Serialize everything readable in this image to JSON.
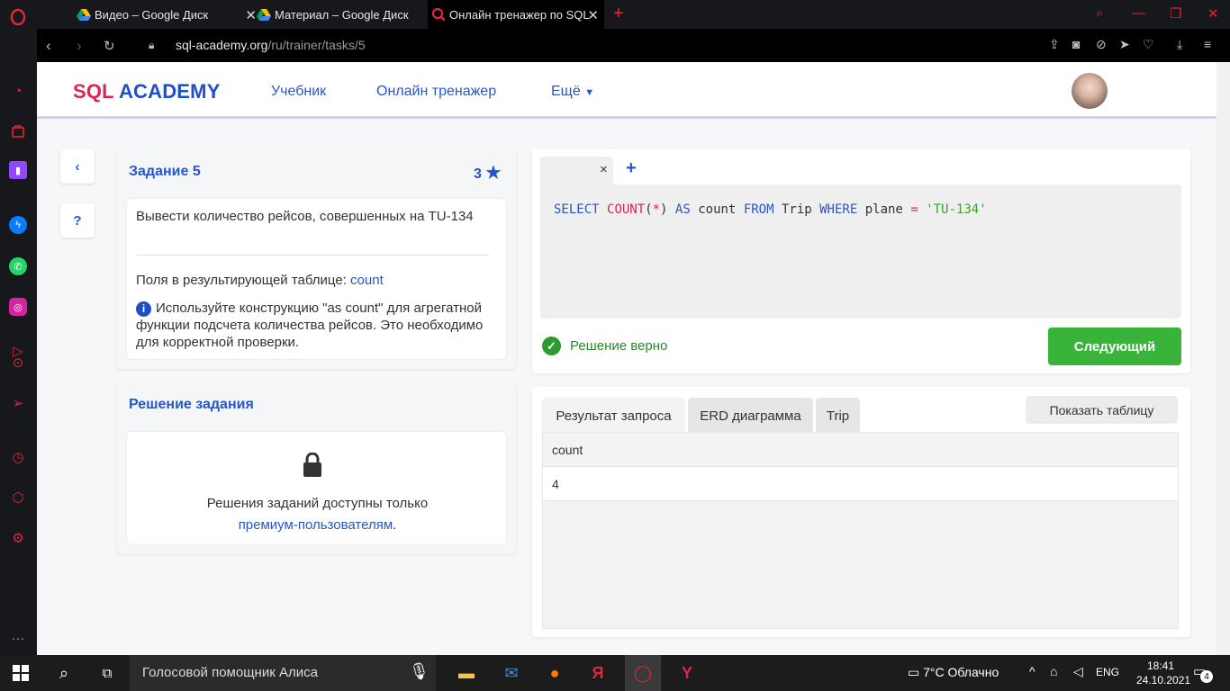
{
  "browser": {
    "tabs": [
      {
        "title": "Видео – Google Диск"
      },
      {
        "title": "Материал – Google Диск"
      },
      {
        "title": "Онлайн тренажер по SQL"
      }
    ],
    "url_host": "sql-academy.org",
    "url_path": "/ru/trainer/tasks/5"
  },
  "header": {
    "logo_sql": "SQL",
    "logo_academy": "ACADEMY",
    "nav": [
      "Учебник",
      "Онлайн тренажер",
      "Ещё"
    ]
  },
  "side_buttons": {
    "back": "‹",
    "help": "?"
  },
  "task": {
    "title": "Задание 5",
    "stars": "3",
    "description": "Вывести количество рейсов, совершенных на TU-134",
    "fields_label": "Поля в результирующей таблице:",
    "fields_value": "count",
    "hint": "Используйте конструкцию \"as count\" для агрегатной функции подсчета количества рейсов. Это необходимо для корректной проверки."
  },
  "solution": {
    "title": "Решение задания",
    "locked_text": "Решения заданий доступны только",
    "locked_link": "премиум-пользователям",
    "locked_suffix": "."
  },
  "editor": {
    "tab_close": "×",
    "tab_add": "+",
    "code": {
      "k1": "SELECT",
      "f1": "COUNT",
      "p1": "(",
      "star": "*",
      "p2": ")",
      "k2": "AS",
      "t1": "count",
      "k3": "FROM",
      "t2": "Trip",
      "k4": "WHERE",
      "t3": "plane",
      "eq": "=",
      "s1": "'TU-134'"
    },
    "status": "Решение верно",
    "next_button": "Следующий"
  },
  "results": {
    "tabs": [
      "Результат запроса",
      "ERD диаграмма",
      "Trip"
    ],
    "show_table_button": "Показать таблицу",
    "columns": [
      "count"
    ],
    "rows": [
      [
        "4"
      ]
    ]
  },
  "taskbar": {
    "search_placeholder": "Голосовой помощник Алиса",
    "weather": "7°C  Облачно",
    "lang": "ENG",
    "time": "18:41",
    "date": "24.10.2021",
    "notifications": "4"
  },
  "colors": {
    "accent": "#2457cc",
    "logo_red": "#e0244f",
    "success": "#3ab33a",
    "opera_red": "#e0263a"
  }
}
